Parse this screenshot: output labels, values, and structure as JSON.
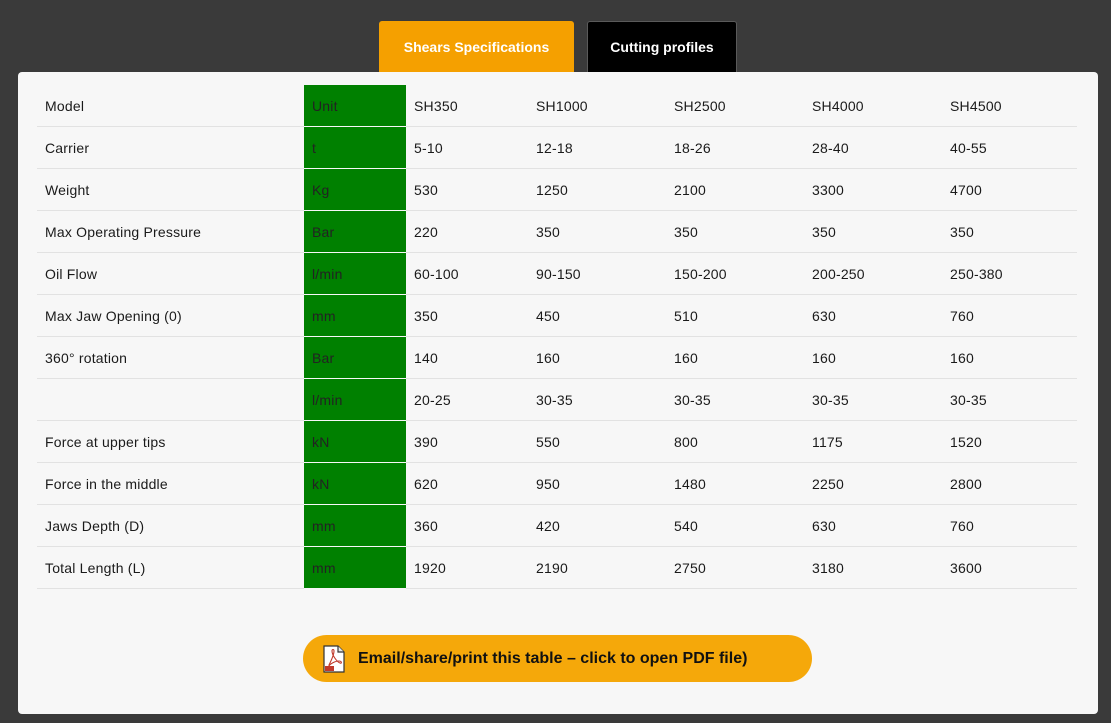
{
  "tabs": {
    "active": "Shears Specifications",
    "other": "Cutting profiles"
  },
  "table": {
    "header": {
      "param": "Model",
      "unit": "Unit",
      "models": [
        "SH350",
        "SH1000",
        "SH2500",
        "SH4000",
        "SH4500"
      ]
    },
    "rows": [
      {
        "param": "Carrier",
        "unit": "t",
        "values": [
          "5-10",
          "12-18",
          "18-26",
          "28-40",
          "40-55"
        ]
      },
      {
        "param": "Weight",
        "unit": "Kg",
        "values": [
          "530",
          "1250",
          "2100",
          "3300",
          "4700"
        ]
      },
      {
        "param": "Max Operating Pressure",
        "unit": "Bar",
        "values": [
          "220",
          "350",
          "350",
          "350",
          "350"
        ]
      },
      {
        "param": "Oil Flow",
        "unit": "l/min",
        "values": [
          "60-100",
          "90-150",
          "150-200",
          "200-250",
          "250-380"
        ]
      },
      {
        "param": "Max Jaw Opening (0)",
        "unit": "mm",
        "values": [
          "350",
          "450",
          "510",
          "630",
          "760"
        ]
      },
      {
        "param": "360° rotation",
        "unit": "Bar",
        "values": [
          "140",
          "160",
          "160",
          "160",
          "160"
        ]
      },
      {
        "param": "",
        "unit": "l/min",
        "values": [
          "20-25",
          "30-35",
          "30-35",
          "30-35",
          "30-35"
        ]
      },
      {
        "param": "Force at upper tips",
        "unit": "kN",
        "values": [
          "390",
          "550",
          "800",
          "1175",
          "1520"
        ]
      },
      {
        "param": "Force in the middle",
        "unit": "kN",
        "values": [
          "620",
          "950",
          "1480",
          "2250",
          "2800"
        ]
      },
      {
        "param": "Jaws Depth (D)",
        "unit": "mm",
        "values": [
          "360",
          "420",
          "540",
          "630",
          "760"
        ]
      },
      {
        "param": "Total Length (L)",
        "unit": "mm",
        "values": [
          "1920",
          "2190",
          "2750",
          "3180",
          "3600"
        ]
      }
    ]
  },
  "pdf_button": {
    "label": "Email/share/print this table – click to open PDF file)",
    "icon": "pdf-file-icon"
  },
  "colors": {
    "accent": "#f5a000",
    "unit_column": "#008000",
    "background": "#3a3a3a",
    "panel": "#f7f7f7"
  }
}
